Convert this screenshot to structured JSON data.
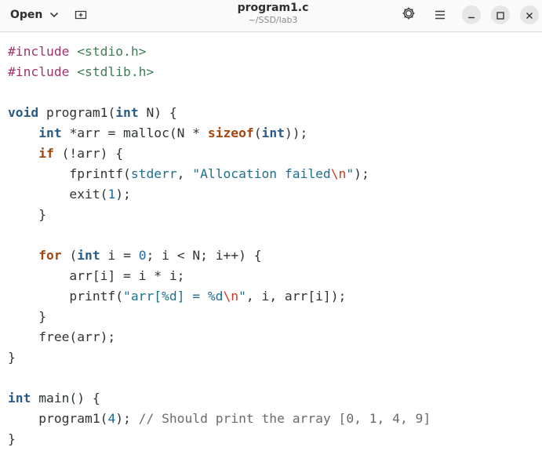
{
  "headerbar": {
    "open_label": "Open",
    "title": "program1.c",
    "subtitle": "~/SSD/lab3",
    "icons": {
      "open_dropdown": "chevron-down-icon",
      "new_tab": "new-tab-icon",
      "status": "settings-gear-icon",
      "menu": "hamburger-menu-icon",
      "minimize": "minimize-icon",
      "maximize": "maximize-icon",
      "close": "close-icon"
    }
  },
  "editor": {
    "language": "c",
    "lines": [
      [
        {
          "t": "pp",
          "v": "#include "
        },
        {
          "t": "inc",
          "v": "<stdio.h>"
        }
      ],
      [
        {
          "t": "pp",
          "v": "#include "
        },
        {
          "t": "inc",
          "v": "<stdlib.h>"
        }
      ],
      [],
      [
        {
          "t": "ty",
          "v": "void"
        },
        {
          "t": "",
          "v": " program1("
        },
        {
          "t": "ty",
          "v": "int"
        },
        {
          "t": "",
          "v": " N) {"
        }
      ],
      [
        {
          "t": "",
          "v": "    "
        },
        {
          "t": "ty",
          "v": "int"
        },
        {
          "t": "",
          "v": " *arr = malloc(N * "
        },
        {
          "t": "kw",
          "v": "sizeof"
        },
        {
          "t": "",
          "v": "("
        },
        {
          "t": "ty",
          "v": "int"
        },
        {
          "t": "",
          "v": "));"
        }
      ],
      [
        {
          "t": "",
          "v": "    "
        },
        {
          "t": "kw",
          "v": "if"
        },
        {
          "t": "",
          "v": " (!arr) {"
        }
      ],
      [
        {
          "t": "",
          "v": "        fprintf("
        },
        {
          "t": "str",
          "v": "stderr"
        },
        {
          "t": "",
          "v": ", "
        },
        {
          "t": "str",
          "v": "\"Allocation failed"
        },
        {
          "t": "esc",
          "v": "\\n"
        },
        {
          "t": "str",
          "v": "\""
        },
        {
          "t": "",
          "v": ");"
        }
      ],
      [
        {
          "t": "",
          "v": "        exit("
        },
        {
          "t": "num",
          "v": "1"
        },
        {
          "t": "",
          "v": ");"
        }
      ],
      [
        {
          "t": "",
          "v": "    }"
        }
      ],
      [],
      [
        {
          "t": "",
          "v": "    "
        },
        {
          "t": "kw",
          "v": "for"
        },
        {
          "t": "",
          "v": " ("
        },
        {
          "t": "ty",
          "v": "int"
        },
        {
          "t": "",
          "v": " i = "
        },
        {
          "t": "num",
          "v": "0"
        },
        {
          "t": "",
          "v": "; i < N; i++) {"
        }
      ],
      [
        {
          "t": "",
          "v": "        arr[i] = i * i;"
        }
      ],
      [
        {
          "t": "",
          "v": "        printf("
        },
        {
          "t": "str",
          "v": "\"arr[%d] = %d"
        },
        {
          "t": "esc",
          "v": "\\n"
        },
        {
          "t": "str",
          "v": "\""
        },
        {
          "t": "",
          "v": ", i, arr[i]);"
        }
      ],
      [
        {
          "t": "",
          "v": "    }"
        }
      ],
      [
        {
          "t": "",
          "v": "    free(arr);"
        }
      ],
      [
        {
          "t": "",
          "v": "}"
        }
      ],
      [],
      [
        {
          "t": "ty",
          "v": "int"
        },
        {
          "t": "",
          "v": " main() {"
        }
      ],
      [
        {
          "t": "",
          "v": "    program1("
        },
        {
          "t": "num",
          "v": "4"
        },
        {
          "t": "",
          "v": "); "
        },
        {
          "t": "cm",
          "v": "// Should print the array [0, 1, 4, 9]"
        }
      ],
      [
        {
          "t": "",
          "v": "}"
        }
      ]
    ]
  }
}
